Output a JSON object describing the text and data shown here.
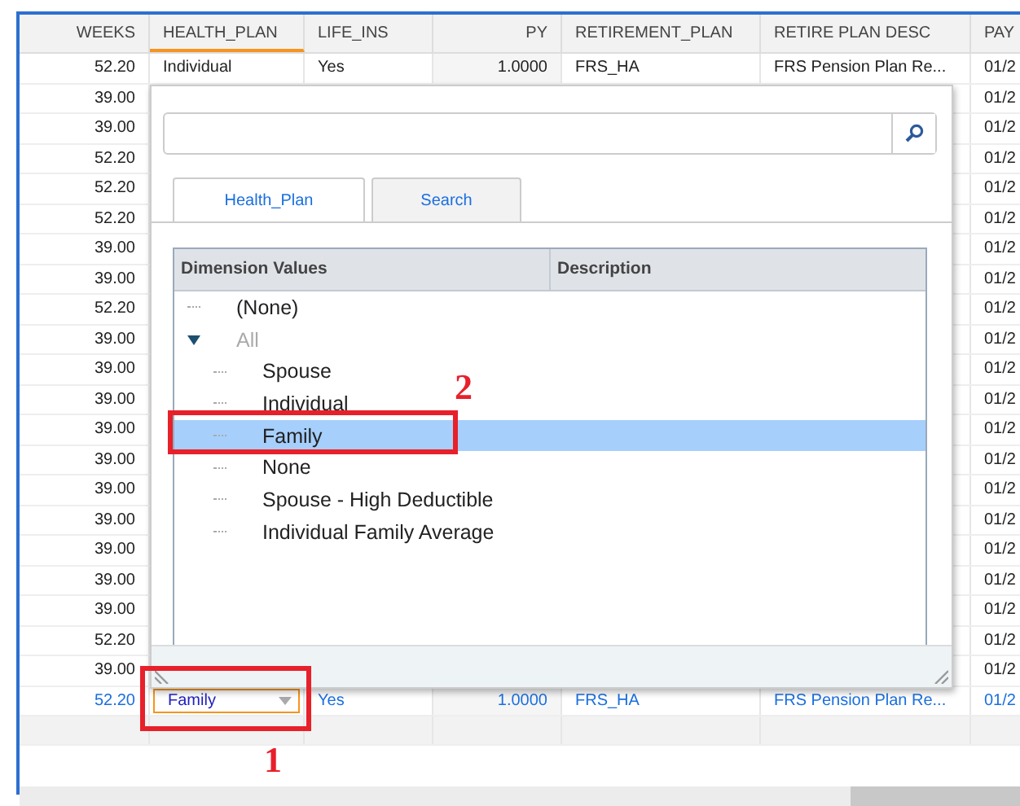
{
  "grid": {
    "columns": [
      {
        "label": "WEEKS",
        "sorted": false
      },
      {
        "label": "HEALTH_PLAN",
        "sorted": true
      },
      {
        "label": "LIFE_INS",
        "sorted": false
      },
      {
        "label": "PY",
        "sorted": false
      },
      {
        "label": "RETIREMENT_PLAN",
        "sorted": false
      },
      {
        "label": "RETIRE PLAN DESC",
        "sorted": false
      },
      {
        "label": "PAY",
        "sorted": false
      }
    ],
    "rows": [
      {
        "editing": false,
        "cells": [
          "52.20",
          "Individual",
          "Yes",
          "1.0000",
          "FRS_HA",
          "FRS Pension Plan Re...",
          "01/2"
        ]
      },
      {
        "editing": false,
        "cells": [
          "39.00",
          "",
          "",
          "",
          "",
          "",
          "01/2"
        ]
      },
      {
        "editing": false,
        "cells": [
          "39.00",
          "",
          "",
          "",
          "",
          "",
          "01/2"
        ]
      },
      {
        "editing": false,
        "cells": [
          "52.20",
          "",
          "",
          "",
          "",
          "",
          "01/2"
        ]
      },
      {
        "editing": false,
        "cells": [
          "52.20",
          "",
          "",
          "",
          "",
          "",
          "01/2"
        ]
      },
      {
        "editing": false,
        "cells": [
          "52.20",
          "",
          "",
          "",
          "",
          "",
          "01/2"
        ]
      },
      {
        "editing": false,
        "cells": [
          "39.00",
          "",
          "",
          "",
          "",
          "",
          "01/2"
        ]
      },
      {
        "editing": false,
        "cells": [
          "39.00",
          "",
          "",
          "",
          "",
          "",
          "01/2"
        ]
      },
      {
        "editing": false,
        "cells": [
          "52.20",
          "",
          "",
          "",
          "",
          "",
          "01/2"
        ]
      },
      {
        "editing": false,
        "cells": [
          "39.00",
          "",
          "",
          "",
          "",
          "",
          "01/2"
        ]
      },
      {
        "editing": false,
        "cells": [
          "39.00",
          "",
          "",
          "",
          "",
          "",
          "01/2"
        ]
      },
      {
        "editing": false,
        "cells": [
          "39.00",
          "",
          "",
          "",
          "",
          "",
          "01/2"
        ]
      },
      {
        "editing": false,
        "cells": [
          "39.00",
          "",
          "",
          "",
          "",
          "",
          "01/2"
        ]
      },
      {
        "editing": false,
        "cells": [
          "39.00",
          "",
          "",
          "",
          "",
          "",
          "01/2"
        ]
      },
      {
        "editing": false,
        "cells": [
          "39.00",
          "",
          "",
          "",
          "",
          "",
          "01/2"
        ]
      },
      {
        "editing": false,
        "cells": [
          "39.00",
          "",
          "",
          "",
          "",
          "",
          "01/2"
        ]
      },
      {
        "editing": false,
        "cells": [
          "39.00",
          "",
          "",
          "",
          "",
          "",
          "01/2"
        ]
      },
      {
        "editing": false,
        "cells": [
          "39.00",
          "",
          "",
          "",
          "",
          "",
          "01/2"
        ]
      },
      {
        "editing": false,
        "cells": [
          "39.00",
          "",
          "",
          "",
          "",
          "",
          "01/2"
        ]
      },
      {
        "editing": false,
        "cells": [
          "52.20",
          "",
          "",
          "",
          "",
          "",
          "01/2"
        ]
      },
      {
        "editing": false,
        "cells": [
          "39.00",
          "",
          "",
          "",
          "",
          "",
          "01/2"
        ]
      },
      {
        "editing": true,
        "cells": [
          "52.20",
          "Family",
          "Yes",
          "1.0000",
          "FRS_HA",
          "FRS Pension Plan Re...",
          "01/2"
        ]
      }
    ]
  },
  "popup": {
    "tabs": [
      {
        "label": "Health_Plan",
        "selected": true
      },
      {
        "label": "Search",
        "selected": false
      }
    ],
    "tree_columns": [
      "Dimension Values",
      "Description"
    ],
    "tree": [
      {
        "label": "(None)",
        "selected": false,
        "muted": false
      },
      {
        "label": "All",
        "selected": false,
        "muted": true,
        "expanded": true,
        "children": [
          {
            "label": "Spouse",
            "selected": false,
            "muted": false
          },
          {
            "label": "Individual",
            "selected": false,
            "muted": false
          },
          {
            "label": "Family",
            "selected": true,
            "muted": false
          },
          {
            "label": "None",
            "selected": false,
            "muted": false
          },
          {
            "label": "Spouse - High Deductible",
            "selected": false,
            "muted": false
          },
          {
            "label": "Individual Family Average",
            "selected": false,
            "muted": false
          }
        ]
      }
    ]
  },
  "annotations": [
    "1",
    "2"
  ]
}
